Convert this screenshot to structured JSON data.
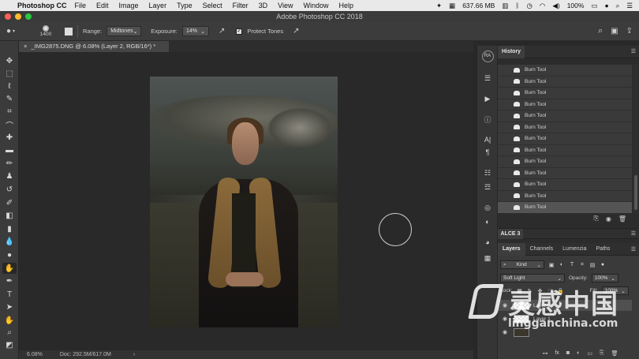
{
  "menubar": {
    "app_name": "Photoshop CC",
    "items": [
      "File",
      "Edit",
      "Image",
      "Layer",
      "Type",
      "Select",
      "Filter",
      "3D",
      "View",
      "Window",
      "Help"
    ],
    "memory": "637.66 MB",
    "battery": "100%",
    "colors": {
      "bar": "#e9e9e9"
    }
  },
  "window": {
    "title": "Adobe Photoshop CC 2018"
  },
  "options": {
    "brush_size": "1400",
    "range_label": "Range:",
    "range_value": "Midtones",
    "exposure_label": "Exposure:",
    "exposure_value": "14%",
    "protect_tones_label": "Protect Tones"
  },
  "document": {
    "tab_title": "_IMG2875.DNG @ 6.08% (Layer 2, RGB/16*) *",
    "zoom": "6.08%",
    "doc_size": "Doc: 292.5M/617.0M",
    "status_arrow": "›"
  },
  "dock": {
    "ra_label": "RA"
  },
  "history": {
    "tab_label": "History",
    "items": [
      "Burn Tool",
      "Burn Tool",
      "Burn Tool",
      "Burn Tool",
      "Burn Tool",
      "Burn Tool",
      "Burn Tool",
      "Burn Tool",
      "Burn Tool",
      "Burn Tool",
      "Burn Tool",
      "Burn Tool",
      "Burn Tool"
    ]
  },
  "alce": {
    "tab_label": "ALCE 3"
  },
  "layers": {
    "tabs": [
      "Layers",
      "Channels",
      "Lumenzia",
      "Paths"
    ],
    "kind_label": "Kind",
    "blend_mode": "Soft Light",
    "opacity_label": "Opacity:",
    "opacity_value": "100%",
    "lock_label": "Lock:",
    "fill_label": "Fill:",
    "fill_value": "100%",
    "layer_names": [
      "Layer 2",
      "Layer 1"
    ]
  },
  "watermark": {
    "cn": "灵感中国",
    "url": "lingganchina.com"
  }
}
